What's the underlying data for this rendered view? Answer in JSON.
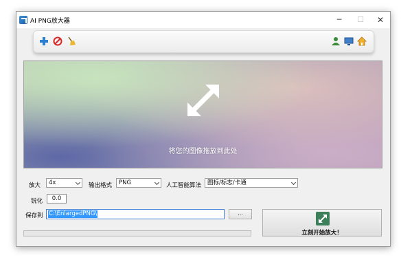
{
  "window": {
    "title": "AI PNG放大器",
    "minimize": "─",
    "maximize": "☐",
    "close": "✕"
  },
  "toolbar": {
    "add_icon": "plus-icon",
    "remove_icon": "no-entry-icon",
    "clear_icon": "broom-icon",
    "user_icon": "user-icon",
    "screen_icon": "monitor-icon",
    "home_icon": "home-icon"
  },
  "dropzone": {
    "text": "将您的图像拖放到此处"
  },
  "settings": {
    "scale_label": "放大",
    "scale_value": "4x",
    "format_label": "输出格式",
    "format_value": "PNG",
    "algorithm_label": "人工智能算法",
    "algorithm_value": "图标/标志/卡通",
    "sharpen_label": "锐化",
    "sharpen_value": "0.0",
    "save_label": "保存到",
    "save_path": "C:\\EnlargedPNG\\",
    "browse_label": "..."
  },
  "progress": {
    "value": 0
  },
  "start": {
    "label": "立刻开始放大！"
  },
  "colors": {
    "accent": "#3399ff",
    "progress": "#06b025"
  }
}
